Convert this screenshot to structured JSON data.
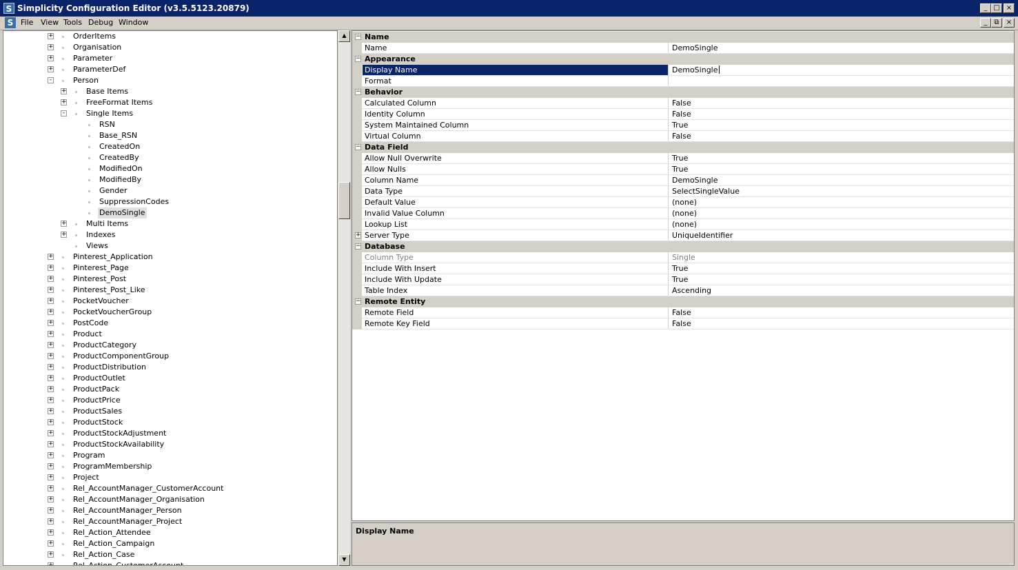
{
  "window": {
    "title": "Simplicity Configuration Editor (v3.5.5123.20879)",
    "app_icon": "S",
    "controls": [
      "_",
      "□",
      "×"
    ],
    "mdi_controls": [
      "_",
      "⧉",
      "×"
    ]
  },
  "menu": [
    "File",
    "View",
    "Tools",
    "Debug",
    "Window"
  ],
  "tree": [
    {
      "label": "OrderItems",
      "level": 0,
      "exp": "+"
    },
    {
      "label": "Organisation",
      "level": 0,
      "exp": "+"
    },
    {
      "label": "Parameter",
      "level": 0,
      "exp": "+"
    },
    {
      "label": "ParameterDef",
      "level": 0,
      "exp": "+"
    },
    {
      "label": "Person",
      "level": 0,
      "exp": "-"
    },
    {
      "label": "Base Items",
      "level": 1,
      "exp": "+"
    },
    {
      "label": "FreeFormat Items",
      "level": 1,
      "exp": "+"
    },
    {
      "label": "Single Items",
      "level": 1,
      "exp": "-"
    },
    {
      "label": "RSN",
      "level": 2,
      "exp": ""
    },
    {
      "label": "Base_RSN",
      "level": 2,
      "exp": ""
    },
    {
      "label": "CreatedOn",
      "level": 2,
      "exp": ""
    },
    {
      "label": "CreatedBy",
      "level": 2,
      "exp": ""
    },
    {
      "label": "ModifiedOn",
      "level": 2,
      "exp": ""
    },
    {
      "label": "ModifiedBy",
      "level": 2,
      "exp": ""
    },
    {
      "label": "Gender",
      "level": 2,
      "exp": ""
    },
    {
      "label": "SuppressionCodes",
      "level": 2,
      "exp": ""
    },
    {
      "label": "DemoSingle",
      "level": 2,
      "exp": "",
      "selected": true
    },
    {
      "label": "Multi Items",
      "level": 1,
      "exp": "+"
    },
    {
      "label": "Indexes",
      "level": 1,
      "exp": "+"
    },
    {
      "label": "Views",
      "level": 1,
      "exp": ""
    },
    {
      "label": "Pinterest_Application",
      "level": 0,
      "exp": "+"
    },
    {
      "label": "Pinterest_Page",
      "level": 0,
      "exp": "+"
    },
    {
      "label": "Pinterest_Post",
      "level": 0,
      "exp": "+"
    },
    {
      "label": "Pinterest_Post_Like",
      "level": 0,
      "exp": "+"
    },
    {
      "label": "PocketVoucher",
      "level": 0,
      "exp": "+"
    },
    {
      "label": "PocketVoucherGroup",
      "level": 0,
      "exp": "+"
    },
    {
      "label": "PostCode",
      "level": 0,
      "exp": "+"
    },
    {
      "label": "Product",
      "level": 0,
      "exp": "+"
    },
    {
      "label": "ProductCategory",
      "level": 0,
      "exp": "+"
    },
    {
      "label": "ProductComponentGroup",
      "level": 0,
      "exp": "+"
    },
    {
      "label": "ProductDistribution",
      "level": 0,
      "exp": "+"
    },
    {
      "label": "ProductOutlet",
      "level": 0,
      "exp": "+"
    },
    {
      "label": "ProductPack",
      "level": 0,
      "exp": "+"
    },
    {
      "label": "ProductPrice",
      "level": 0,
      "exp": "+"
    },
    {
      "label": "ProductSales",
      "level": 0,
      "exp": "+"
    },
    {
      "label": "ProductStock",
      "level": 0,
      "exp": "+"
    },
    {
      "label": "ProductStockAdjustment",
      "level": 0,
      "exp": "+"
    },
    {
      "label": "ProductStockAvailability",
      "level": 0,
      "exp": "+"
    },
    {
      "label": "Program",
      "level": 0,
      "exp": "+"
    },
    {
      "label": "ProgramMembership",
      "level": 0,
      "exp": "+"
    },
    {
      "label": "Project",
      "level": 0,
      "exp": "+"
    },
    {
      "label": "Rel_AccountManager_CustomerAccount",
      "level": 0,
      "exp": "+"
    },
    {
      "label": "Rel_AccountManager_Organisation",
      "level": 0,
      "exp": "+"
    },
    {
      "label": "Rel_AccountManager_Person",
      "level": 0,
      "exp": "+"
    },
    {
      "label": "Rel_AccountManager_Project",
      "level": 0,
      "exp": "+"
    },
    {
      "label": "Rel_Action_Attendee",
      "level": 0,
      "exp": "+"
    },
    {
      "label": "Rel_Action_Campaign",
      "level": 0,
      "exp": "+"
    },
    {
      "label": "Rel_Action_Case",
      "level": 0,
      "exp": "+"
    },
    {
      "label": "Rel_Action_CustomerAccount",
      "level": 0,
      "exp": "+"
    }
  ],
  "property_grid": [
    {
      "category": "Name",
      "props": [
        {
          "name": "Name",
          "value": "DemoSingle"
        }
      ]
    },
    {
      "category": "Appearance",
      "props": [
        {
          "name": "Display Name",
          "value": "DemoSingle",
          "selected": true
        },
        {
          "name": "Format",
          "value": ""
        }
      ]
    },
    {
      "category": "Behavior",
      "props": [
        {
          "name": "Calculated Column",
          "value": "False"
        },
        {
          "name": "Identity Column",
          "value": "False"
        },
        {
          "name": "System Maintained Column",
          "value": "True"
        },
        {
          "name": "Virtual Column",
          "value": "False"
        }
      ]
    },
    {
      "category": "Data Field",
      "props": [
        {
          "name": "Allow Null Overwrite",
          "value": "True"
        },
        {
          "name": "Allow Nulls",
          "value": "True"
        },
        {
          "name": "Column Name",
          "value": "DemoSingle"
        },
        {
          "name": "Data Type",
          "value": "SelectSingleValue"
        },
        {
          "name": "Default Value",
          "value": "(none)"
        },
        {
          "name": "Invalid Value Column",
          "value": "(none)"
        },
        {
          "name": "Lookup List",
          "value": "(none)"
        },
        {
          "name": "Server Type",
          "value": "UniqueIdentifier",
          "expandable": true
        }
      ]
    },
    {
      "category": "Database",
      "props": [
        {
          "name": "Column Type",
          "value": "Single",
          "greyed": true
        },
        {
          "name": "Include With Insert",
          "value": "True"
        },
        {
          "name": "Include With Update",
          "value": "True"
        },
        {
          "name": "Table Index",
          "value": "Ascending"
        }
      ]
    },
    {
      "category": "Remote Entity",
      "props": [
        {
          "name": "Remote Field",
          "value": "False"
        },
        {
          "name": "Remote Key Field",
          "value": "False"
        }
      ]
    }
  ],
  "help": {
    "title": "Display Name",
    "description": ""
  }
}
